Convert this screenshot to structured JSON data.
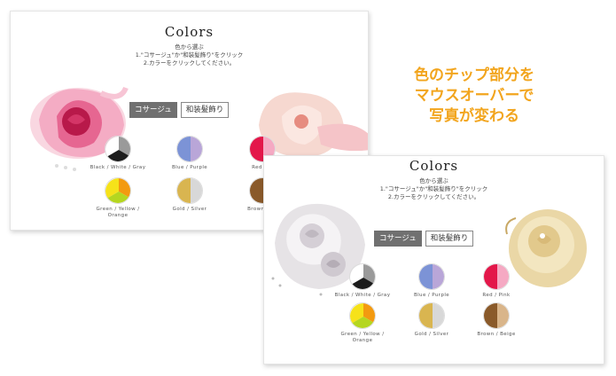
{
  "callout": {
    "line1": "色のチップ部分を",
    "line2": "マウスオーバーで",
    "line3": "写真が変わる"
  },
  "panel_back": {
    "title": "Colors",
    "instruction_heading": "色から選ぶ",
    "instruction_1": "1.\"コサージュ\"か\"和装髪飾り\"をクリック",
    "instruction_2": "2.カラーをクリックしてください。",
    "tabs": [
      {
        "label": "コサージュ",
        "active": true
      },
      {
        "label": "和装髪飾り",
        "active": false
      }
    ],
    "chips": [
      {
        "label": "Black / White / Gray",
        "icon": "black-white-gray-swatch-icon"
      },
      {
        "label": "Blue / Purple",
        "icon": "blue-purple-swatch-icon"
      },
      {
        "label": "Red / Pi",
        "icon": "red-pink-swatch-icon"
      },
      {
        "label": "Green / Yellow / Orange",
        "icon": "green-yellow-orange-swatch-icon"
      },
      {
        "label": "Gold / Silver",
        "icon": "gold-silver-swatch-icon"
      },
      {
        "label": "Brown / Be",
        "icon": "brown-beige-swatch-icon"
      }
    ],
    "image": "pink-rose-corsage"
  },
  "panel_front": {
    "title": "Colors",
    "instruction_heading": "色から選ぶ",
    "instruction_1": "1.\"コサージュ\"か\"和装髪飾り\"をクリック",
    "instruction_2": "2.カラーをクリックしてください。",
    "tabs": [
      {
        "label": "コサージュ",
        "active": true
      },
      {
        "label": "和装髪飾り",
        "active": false
      }
    ],
    "chips": [
      {
        "label": "Black / White / Gray",
        "icon": "black-white-gray-swatch-icon"
      },
      {
        "label": "Blue / Purple",
        "icon": "blue-purple-swatch-icon"
      },
      {
        "label": "Red / Pink",
        "icon": "red-pink-swatch-icon"
      },
      {
        "label": "Green / Yellow / Orange",
        "icon": "green-yellow-orange-swatch-icon"
      },
      {
        "label": "Gold / Silver",
        "icon": "gold-silver-swatch-icon"
      },
      {
        "label": "Brown / Beige",
        "icon": "brown-beige-swatch-icon"
      }
    ],
    "image": "white-rose-corsage"
  },
  "colors": {
    "callout": "#f2a51e",
    "tab_active_bg": "#707070",
    "black": "#1c1c1c",
    "white": "#ffffff",
    "gray": "#9a9a9a",
    "blue": "#7c93d6",
    "purple": "#b9a6d8",
    "red": "#e3174a",
    "pink": "#f5a9c3",
    "green": "#b5d620",
    "yellow": "#f6e21a",
    "orange": "#f39a10",
    "gold": "#d9b550",
    "silver": "#d8d8d8",
    "brown": "#8a5a2a",
    "beige": "#d9b58a"
  }
}
